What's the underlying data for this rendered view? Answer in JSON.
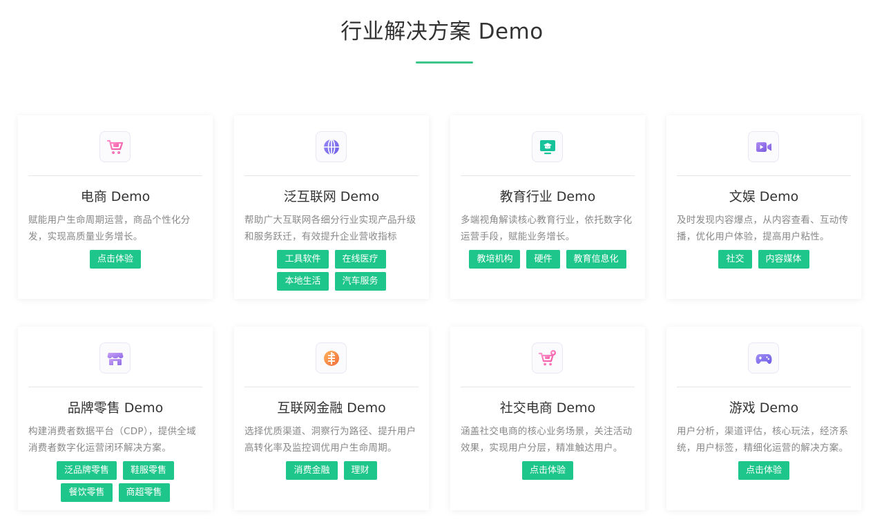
{
  "section": {
    "title": "行业解决方案 Demo"
  },
  "colors": {
    "accent": "#1fc68b",
    "title_line": "#3cc68a"
  },
  "cards": [
    {
      "icon": "shopping-cart-icon",
      "title": "电商 Demo",
      "desc": "赋能用户生命周期运营，商品个性化分发，实现高质量业务增长。",
      "tags": [
        "点击体验"
      ]
    },
    {
      "icon": "globe-icon",
      "title": "泛互联网 Demo",
      "desc": "帮助广大互联网各细分行业实现产品升级和服务跃迁，有效提升企业营收指标",
      "tags": [
        "工具软件",
        "在线医疗",
        "本地生活",
        "汽车服务"
      ]
    },
    {
      "icon": "graduation-monitor-icon",
      "title": "教育行业 Demo",
      "desc": "多端视角解读核心教育行业，依托数字化运营手段，赋能业务增长。",
      "tags": [
        "教培机构",
        "硬件",
        "教育信息化"
      ]
    },
    {
      "icon": "video-camera-icon",
      "title": "文娱 Demo",
      "desc": "及时发现内容爆点，从内容查看、互动传播，优化用户体验，提高用户粘性。",
      "tags": [
        "社交",
        "内容媒体"
      ]
    },
    {
      "icon": "storefront-icon",
      "title": "品牌零售 Demo",
      "desc": "构建消费者数据平台（CDP），提供全域消费者数字化运营闭环解决方案。",
      "tags": [
        "泛品牌零售",
        "鞋服零售",
        "餐饮零售",
        "商超零售"
      ]
    },
    {
      "icon": "finance-coin-icon",
      "title": "互联网金融 Demo",
      "desc": "选择优质渠道、洞察行为路径、提升用户高转化率及监控调优用户生命周期。",
      "tags": [
        "消费金融",
        "理财"
      ]
    },
    {
      "icon": "social-cart-icon",
      "title": "社交电商 Demo",
      "desc": "涵盖社交电商的核心业务场景，关注活动效果，实现用户分层，精准触达用户。",
      "tags": [
        "点击体验"
      ]
    },
    {
      "icon": "gamepad-icon",
      "title": "游戏 Demo",
      "desc": "用户分析，渠道评估，核心玩法，经济系统，用户标签，精细化运营的解决方案。",
      "tags": [
        "点击体验"
      ]
    }
  ]
}
